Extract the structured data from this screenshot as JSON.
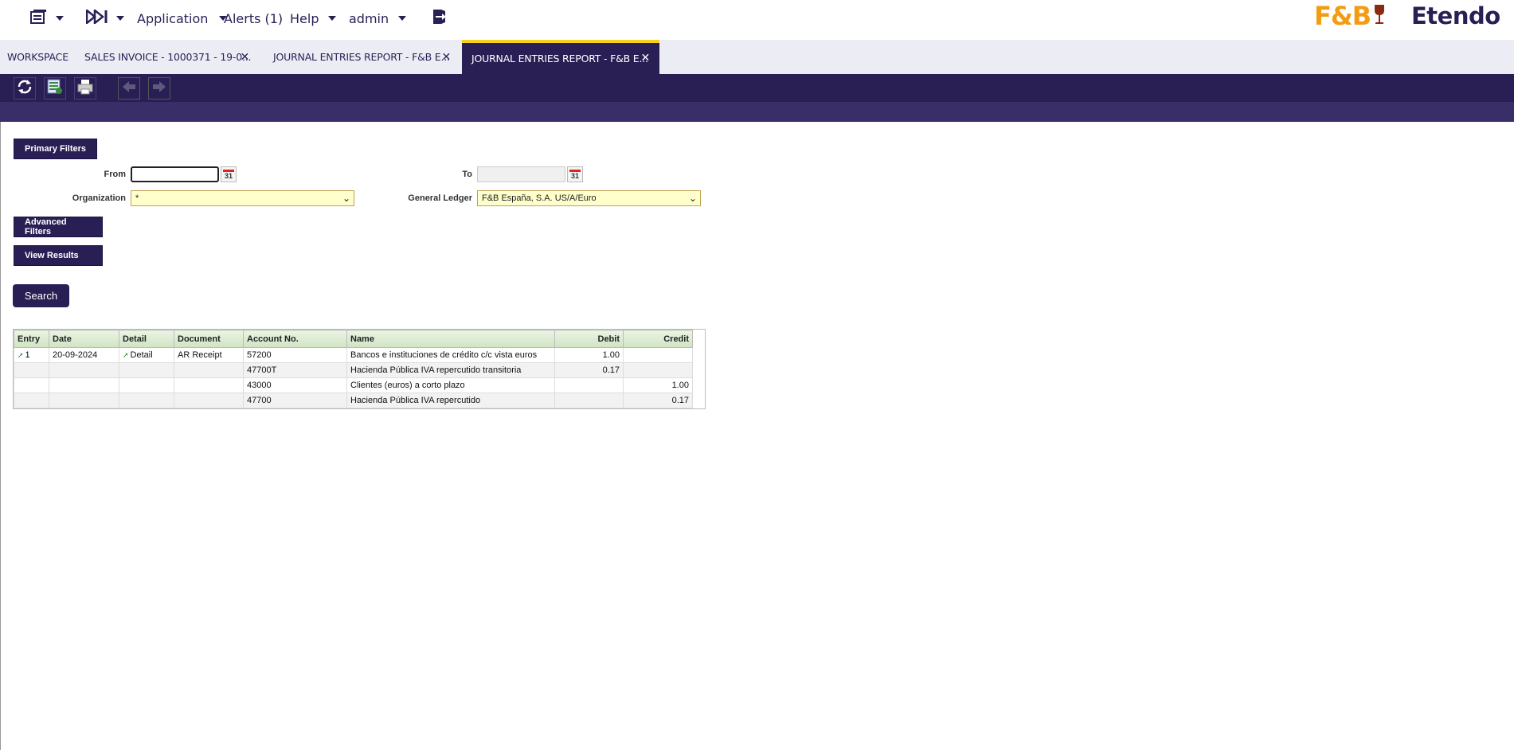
{
  "navbar": {
    "application_label": "Application",
    "alerts_label": "Alerts (1)",
    "help_label": "Help",
    "user_label": "admin",
    "brand_fb": "F&B",
    "brand_etendo": "Etendo"
  },
  "tabs": [
    {
      "label": "WORKSPACE"
    },
    {
      "label": "SALES INVOICE - 1000371 - 19-0..."
    },
    {
      "label": "JOURNAL ENTRIES REPORT - F&B E..."
    },
    {
      "label": "JOURNAL ENTRIES REPORT - F&B E..."
    }
  ],
  "tab_close_glyph": "✕",
  "toolbar": {
    "icons": [
      "refresh-icon",
      "export-spreadsheet-icon",
      "print-icon",
      "previous-icon",
      "next-icon"
    ]
  },
  "filters": {
    "primary_label": "Primary Filters",
    "from_label": "From",
    "from_value": "",
    "to_label": "To",
    "to_value": "",
    "organization_label": "Organization",
    "organization_value": "*",
    "ledger_label": "General Ledger",
    "ledger_value": "F&B España, S.A. US/A/Euro",
    "advanced_label": "Advanced Filters",
    "view_results_label": "View Results",
    "search_label": "Search",
    "calendar_text": "31"
  },
  "report": {
    "columns": [
      "Entry",
      "Date",
      "Detail",
      "Document",
      "Account No.",
      "Name",
      "Debit",
      "Credit"
    ],
    "rows": [
      {
        "entry": "1",
        "date": "20-09-2024",
        "detail": "Detail",
        "document": "AR Receipt",
        "account": "57200",
        "name": "Bancos e instituciones de crédito c/c vista euros",
        "debit": "1.00",
        "credit": ""
      },
      {
        "entry": "",
        "date": "",
        "detail": "",
        "document": "",
        "account": "47700T",
        "name": "Hacienda Pública IVA repercutido transitoria",
        "debit": "0.17",
        "credit": ""
      },
      {
        "entry": "",
        "date": "",
        "detail": "",
        "document": "",
        "account": "43000",
        "name": "Clientes (euros) a corto plazo",
        "debit": "",
        "credit": "1.00"
      },
      {
        "entry": "",
        "date": "",
        "detail": "",
        "document": "",
        "account": "47700",
        "name": "Hacienda Pública IVA repercutido",
        "debit": "",
        "credit": "0.17"
      }
    ]
  },
  "colors": {
    "primary": "#2a1f55",
    "accent": "#f7d21a",
    "brand_orange": "#f39c12",
    "select_bg": "#ffffcc"
  }
}
